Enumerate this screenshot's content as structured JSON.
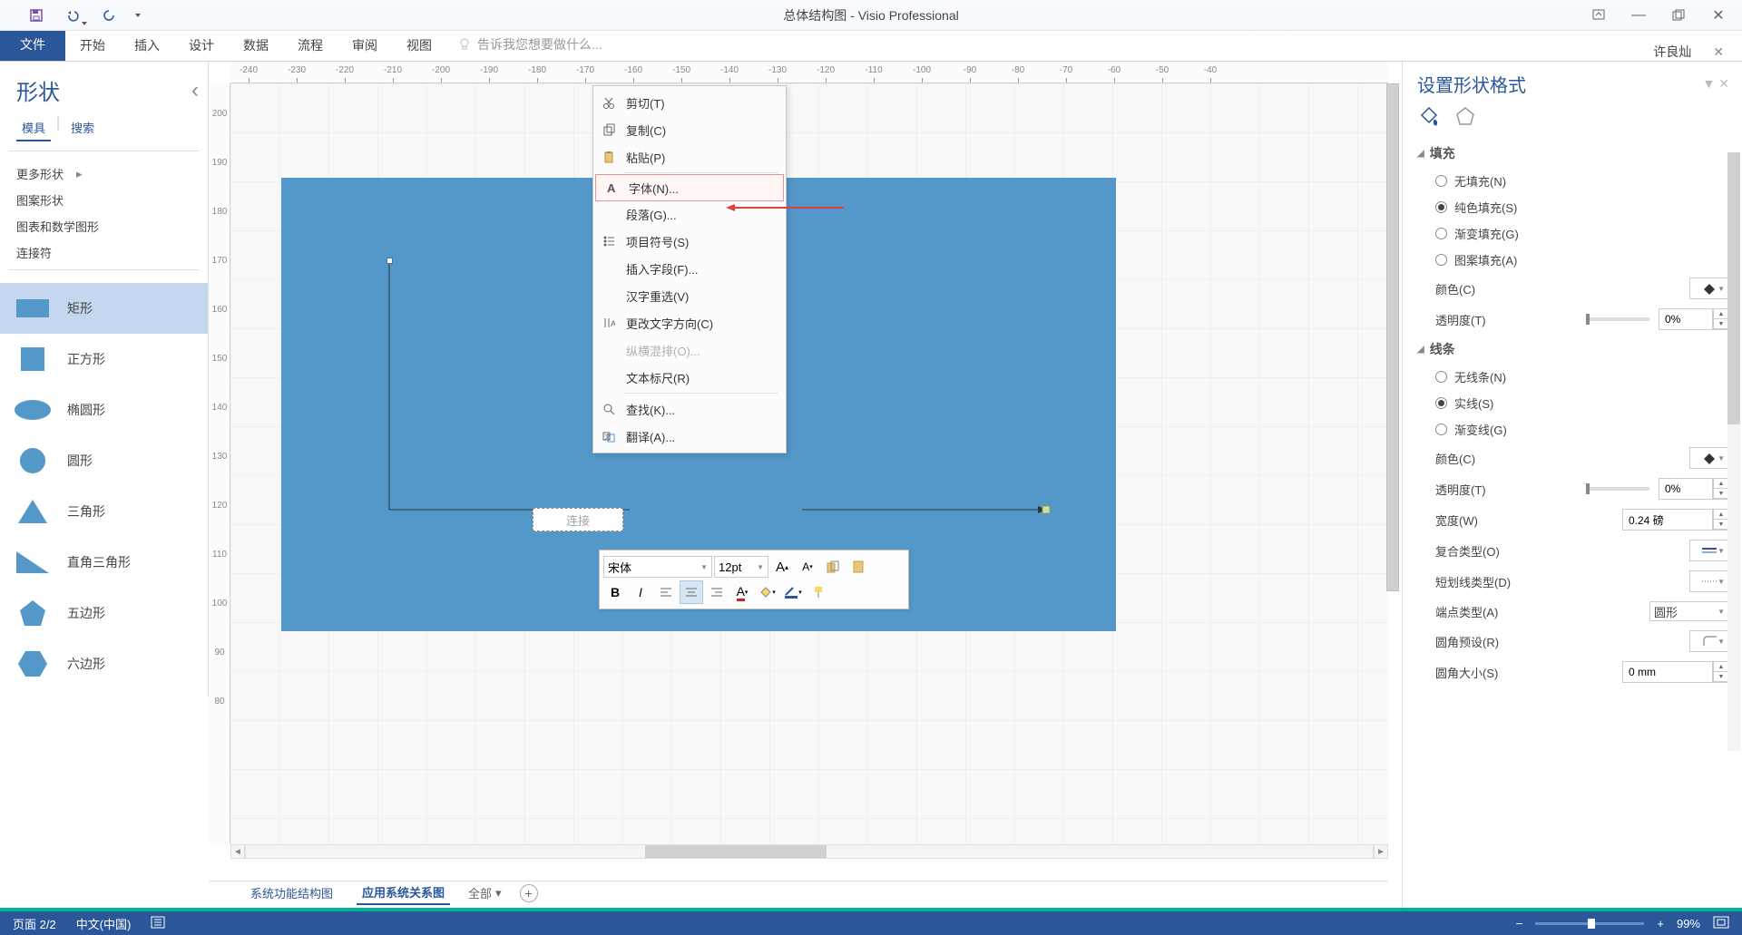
{
  "titlebar": {
    "title": "总体结构图 - Visio Professional"
  },
  "ribbon": {
    "tabs": [
      "文件",
      "开始",
      "插入",
      "设计",
      "数据",
      "流程",
      "审阅",
      "视图"
    ],
    "tellme": "告诉我您想要做什么...",
    "user": "许良灿"
  },
  "shapes_panel": {
    "title": "形状",
    "subtabs": [
      "模具",
      "搜索"
    ],
    "links": [
      "更多形状",
      "图案形状",
      "图表和数学图形",
      "连接符"
    ],
    "items": [
      "矩形",
      "正方形",
      "椭圆形",
      "圆形",
      "三角形",
      "直角三角形",
      "五边形",
      "六边形"
    ]
  },
  "context_menu": {
    "items": [
      {
        "label": "剪切(T)",
        "icon": "cut"
      },
      {
        "label": "复制(C)",
        "icon": "copy"
      },
      {
        "label": "粘贴(P)",
        "icon": "paste"
      },
      {
        "sep": true
      },
      {
        "label": "字体(N)...",
        "icon": "font",
        "highlight": true
      },
      {
        "label": "段落(G)...",
        "icon": ""
      },
      {
        "label": "项目符号(S)",
        "icon": "bullets"
      },
      {
        "label": "插入字段(F)...",
        "icon": ""
      },
      {
        "label": "汉字重选(V)",
        "icon": ""
      },
      {
        "label": "更改文字方向(C)",
        "icon": "textdir"
      },
      {
        "label": "纵横混排(O)...",
        "icon": "",
        "disabled": true
      },
      {
        "label": "文本标尺(R)",
        "icon": ""
      },
      {
        "sep": true
      },
      {
        "label": "查找(K)...",
        "icon": "find"
      },
      {
        "label": "翻译(A)...",
        "icon": "translate"
      }
    ]
  },
  "mini_toolbar": {
    "font": "宋体",
    "size": "12pt"
  },
  "canvas": {
    "textbox": "连接",
    "ruler_h": [
      -240,
      -230,
      -220,
      -210,
      -200,
      -190,
      -180,
      -170,
      -160,
      -150,
      -140,
      -130,
      -120,
      -110,
      -100,
      -90,
      -80,
      -70,
      -60,
      -50,
      -40
    ],
    "ruler_v": [
      200,
      190,
      180,
      170,
      160,
      150,
      140,
      130,
      120,
      110,
      100,
      90,
      80
    ]
  },
  "page_tabs": {
    "tabs": [
      "系统功能结构图",
      "应用系统关系图"
    ],
    "dropdown": "全部"
  },
  "status": {
    "page": "页面 2/2",
    "lang": "中文(中国)",
    "zoom": "99%",
    "time": ""
  },
  "format_panel": {
    "title": "设置形状格式",
    "fill": {
      "header": "填充",
      "opts": [
        "无填充(N)",
        "纯色填充(S)",
        "渐变填充(G)",
        "图案填充(A)"
      ],
      "color_lbl": "颜色(C)",
      "trans_lbl": "透明度(T)",
      "trans_val": "0%"
    },
    "line": {
      "header": "线条",
      "opts": [
        "无线条(N)",
        "实线(S)",
        "渐变线(G)"
      ],
      "color_lbl": "颜色(C)",
      "trans_lbl": "透明度(T)",
      "trans_val": "0%",
      "width_lbl": "宽度(W)",
      "width_val": "0.24 磅",
      "compound_lbl": "复合类型(O)",
      "dash_lbl": "短划线类型(D)",
      "cap_lbl": "端点类型(A)",
      "cap_val": "圆形",
      "corner_lbl": "圆角预设(R)",
      "corner_size_lbl": "圆角大小(S)",
      "corner_size_val": "0 mm"
    }
  }
}
